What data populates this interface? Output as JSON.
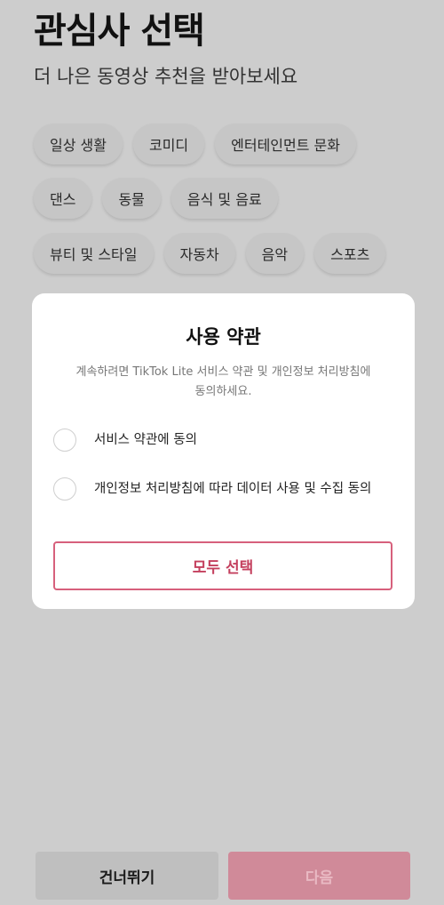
{
  "header": {
    "title": "관심사 선택",
    "subtitle": "더 나은 동영상 추천을 받아보세요"
  },
  "interests": {
    "row1": [
      "일상 생활",
      "코미디",
      "엔터테인먼트 문화"
    ],
    "row2": [
      "댄스",
      "동물",
      "음식 및 음료"
    ],
    "row3": [
      "뷰티 및 스타일",
      "자동차",
      "음악",
      "스포츠"
    ]
  },
  "dialog": {
    "title": "사용 약관",
    "description": "계속하려면 TikTok Lite 서비스 약관 및 개인정보 처리방침에 동의하세요.",
    "items": [
      {
        "label": "서비스 약관에 동의",
        "checked": false
      },
      {
        "label": "개인정보 처리방침에 따라 데이터 사용 및 수집 동의",
        "checked": false
      }
    ],
    "select_all_label": "모두 선택"
  },
  "footer": {
    "skip_label": "건너뛰기",
    "next_label": "다음"
  },
  "colors": {
    "accent": "#c4405e",
    "next_disabled_bg": "#d08a99",
    "overlay_bg": "#cdcdcd"
  }
}
